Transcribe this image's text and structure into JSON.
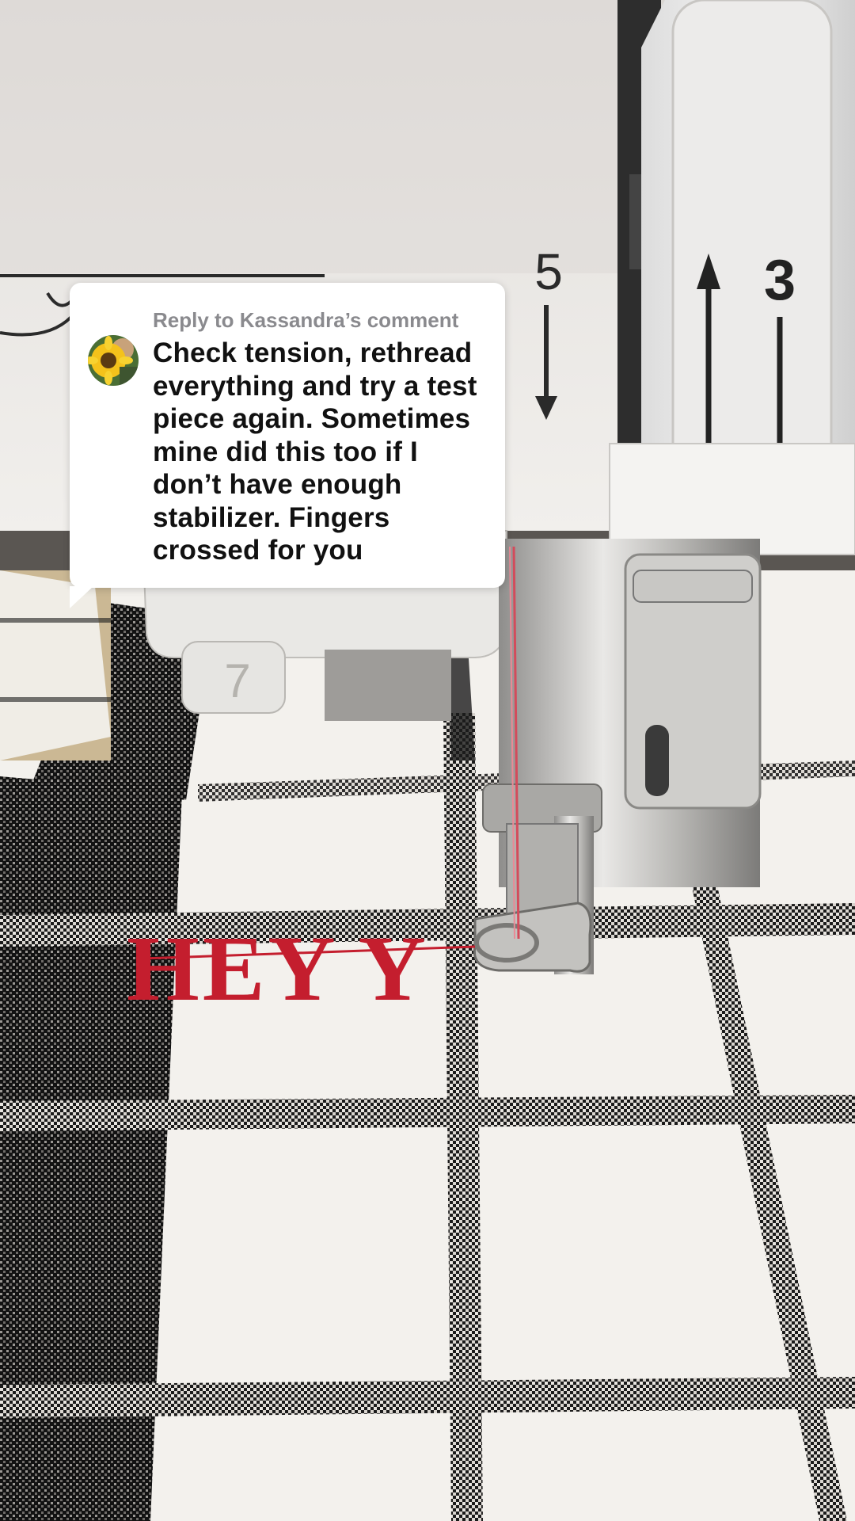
{
  "comment_reply": {
    "header": "Reply to Kassandra’s comment",
    "body": "Check tension, rethread everything and try a test piece again. Sometimes mine did this too if I don’t have enough stabilizer. Fingers crossed for you",
    "avatar": "sunflower-avatar-icon"
  },
  "scene": {
    "dial_left_number": "5",
    "dial_right_number": "3",
    "presser_label": "7",
    "embroidery_text": "HEY Y"
  },
  "colors": {
    "fabric_white": "#f2f0ec",
    "plaid_black": "#1a1a1a",
    "thread_red": "#c41e2e",
    "machine_white": "#ecebe8"
  }
}
